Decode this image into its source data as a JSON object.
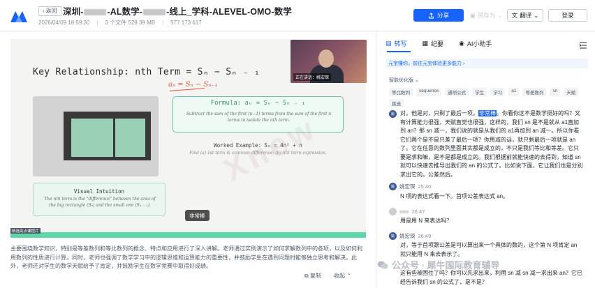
{
  "header": {
    "back_label": "返回",
    "title_part1": "深圳-",
    "title_part2": "-AL数学-",
    "title_part3": "-线上_学科-ALEVEL-OMO-数学",
    "date": "2026/04/09 18:59:30",
    "file_info": "3 个文件 529.39 MB",
    "id": "577 173 617",
    "share_label": "分享",
    "saveas_label": "另存为",
    "translate_label": "翻译",
    "login_label": "登录"
  },
  "slide": {
    "title": "Key Relationship: nth Term = Sₙ − Sₙ ₋ ₁",
    "handwriting": "aₙ = Sₙ − Sₙ₋₁",
    "formula_head": "Formula: aₙ  =  Sₙ  −  Sₙ ₋ ₁",
    "formula_body": "Subtract the sum of the first (n−1) terms from the sum of the first n terms to isolate the nth term.",
    "worked_head": "Worked Example: Sₙ = 4n² + n",
    "worked_sub": "Find (a) 1st term & common difference; (b) nth term expression.",
    "visual_head": "Visual Intuition",
    "visual_body": "The nth term is the \"difference\" between the area of the big rectangle (Sₙ) and the small one (Sₙ ₋ ₁).",
    "speaker_label": "正在讲话：姚宏琛",
    "caption_tip": "非常棒",
    "watermark": "Xnew",
    "progress_tag": "精选亮点课程片",
    "progress": 1.0
  },
  "summary": {
    "text": "主要围绕数学知识，特别是等差数列和等比数列的概念、特点和应用进行了深入讲解。老师通过实例演示了如何求解数列中的各项，以及如何利用数列的性质进行计算。同时，老师也强调了数学学习中的逻辑思维和运算能力的重要性，并鼓励学生在遇到问题时能够独立思考和解决。此外，老师还对学生的数学天赋给予了肯定，并鼓励学生在数学竞赛中取得好成绩。",
    "copy_label": "复制",
    "collapse_label": "收起"
  },
  "sidebar": {
    "tab_transcript": "转写",
    "tab_minutes": "纪要",
    "tab_ai": "AI小助手",
    "banner": "元宝懂你，前往元宝体验更多能力 ›",
    "optimize_label": "智能优化版",
    "chips": [
      "等比数列",
      "sequence",
      "通项公式",
      "学生",
      "学习",
      "a1",
      "等差数列",
      "sn",
      "天赋",
      "挑选"
    ],
    "msg1_prefix": "对。他是对，只剩了最后一项。",
    "msg1_highlight": "非常棒",
    "msg1_rest": "。你看你这不是数学挺好的吗？又有计算能力很强，天赋直觉也很强，这样的，我们 sn 是不是就从 a1直加到 an？那 sn 减一，我们说的就是从我们的 a1再加到 an 减一。所以你看它们两个是不是只差了最后一项？你用减的话，就只剩最后一项就是 an 了。它在任意的数列里面其实都是成立的，不只是我们等比和等差。它只要是求和嘛，是不是都是成立的。我们根据前就能快速的去得到，知道 sn 就可以快速去推导出我们的 an 的公式了。比如说下面，它让我们也是分别求出它的。公差然后。",
    "speaker2_name": "姚宏琛",
    "speaker2_time": "25:40",
    "msg2": "N 项的表达式看一下。首项公差表达式 an。",
    "speaker3_time": "26:47",
    "msg3": "用是用 N 来表达吗？",
    "speaker4_name": "姚宏琛",
    "speaker4_time": "26:49",
    "msg4": "对，等于首项跟公差是可以算出来一个具体的数的，这个第 N 项肯定 an 就只能用 N 来去表示了。",
    "msg5": "这有些被困住了吗？你可以先求出来，利用 sn 减 sn 减一求出来 an？它已经告诉我们 sn 的公式了，是不是？",
    "rwatermark": "公众号 · 犀牛国际教育辅导"
  },
  "colors": {
    "accent": "#1664ff",
    "formula_green": "#6cc4a0",
    "progress_green": "#5fd6a7"
  }
}
